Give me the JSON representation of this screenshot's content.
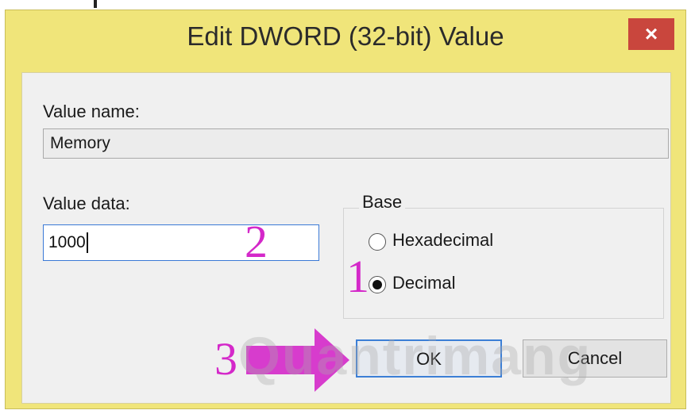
{
  "window": {
    "title": "Edit DWORD (32-bit) Value",
    "close_glyph": "×"
  },
  "form": {
    "value_name_label": "Value name:",
    "value_name": "Memory",
    "value_data_label": "Value data:",
    "value_data": "1000",
    "base_label": "Base",
    "hex_label": "Hexadecimal",
    "decimal_label": "Decimal",
    "selected_base": "Decimal"
  },
  "buttons": {
    "ok": "OK",
    "cancel": "Cancel"
  },
  "annotations": {
    "step1": "1",
    "step2": "2",
    "step3": "3"
  },
  "watermark": "Quantrimang",
  "colors": {
    "frame": "#f0e57a",
    "close": "#c9463d",
    "annotation": "#d428c9",
    "focus": "#3a79d6"
  }
}
